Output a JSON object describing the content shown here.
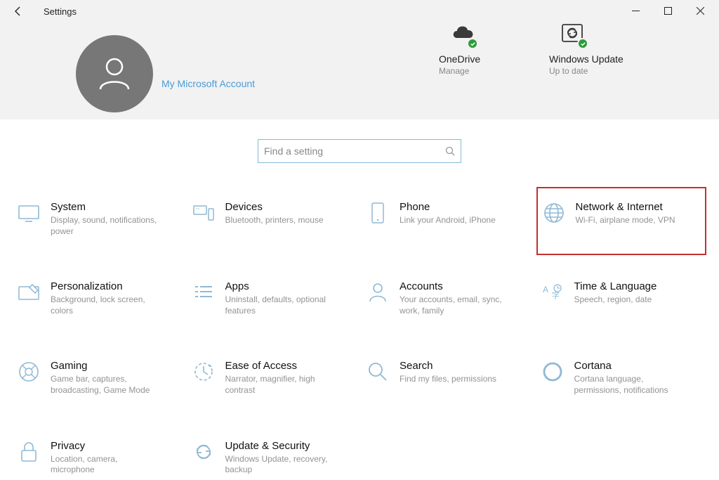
{
  "window": {
    "title": "Settings"
  },
  "account": {
    "link": "My Microsoft Account"
  },
  "status": {
    "onedrive": {
      "title": "OneDrive",
      "sub": "Manage"
    },
    "update": {
      "title": "Windows Update",
      "sub": "Up to date"
    }
  },
  "search": {
    "placeholder": "Find a setting"
  },
  "categories": [
    {
      "id": "system",
      "title": "System",
      "desc": "Display, sound, notifications, power"
    },
    {
      "id": "devices",
      "title": "Devices",
      "desc": "Bluetooth, printers, mouse"
    },
    {
      "id": "phone",
      "title": "Phone",
      "desc": "Link your Android, iPhone"
    },
    {
      "id": "network",
      "title": "Network & Internet",
      "desc": "Wi-Fi, airplane mode, VPN",
      "highlighted": true
    },
    {
      "id": "personalization",
      "title": "Personalization",
      "desc": "Background, lock screen, colors"
    },
    {
      "id": "apps",
      "title": "Apps",
      "desc": "Uninstall, defaults, optional features"
    },
    {
      "id": "accounts",
      "title": "Accounts",
      "desc": "Your accounts, email, sync, work, family"
    },
    {
      "id": "time",
      "title": "Time & Language",
      "desc": "Speech, region, date"
    },
    {
      "id": "gaming",
      "title": "Gaming",
      "desc": "Game bar, captures, broadcasting, Game Mode"
    },
    {
      "id": "ease",
      "title": "Ease of Access",
      "desc": "Narrator, magnifier, high contrast"
    },
    {
      "id": "search",
      "title": "Search",
      "desc": "Find my files, permissions"
    },
    {
      "id": "cortana",
      "title": "Cortana",
      "desc": "Cortana language, permissions, notifications"
    },
    {
      "id": "privacy",
      "title": "Privacy",
      "desc": "Location, camera, microphone"
    },
    {
      "id": "update",
      "title": "Update & Security",
      "desc": "Windows Update, recovery, backup"
    }
  ],
  "colors": {
    "iconBlue": "#8fb9d4",
    "highlight": "#c23030",
    "accent": "#4b9bd6"
  }
}
